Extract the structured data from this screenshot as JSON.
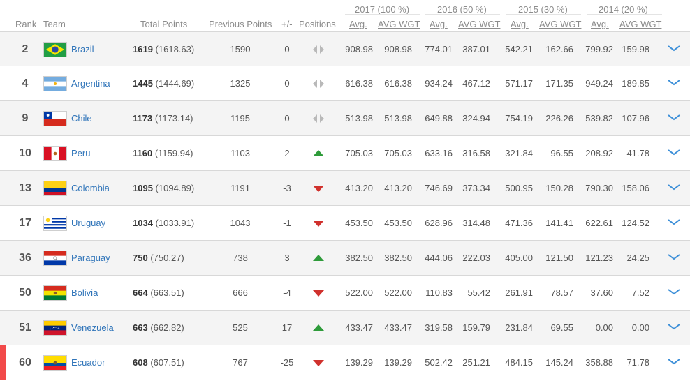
{
  "year_headers": [
    "2017 (100 %)",
    "2016 (50 %)",
    "2015 (30 %)",
    "2014 (20 %)"
  ],
  "columns": {
    "rank": "Rank",
    "team": "Team",
    "total": "Total Points",
    "previous": "Previous Points",
    "change": "+/-",
    "positions": "Positions",
    "avg": "Avg.",
    "avg_wgt": "AVG WGT"
  },
  "colors": {
    "link": "#2f74b9",
    "up": "#2e9b3a",
    "down": "#d0312d",
    "highlight": "#f24a4a"
  },
  "rows": [
    {
      "rank": "2",
      "team": "Brazil",
      "flag": "brazil",
      "total": "1619",
      "total_exact": "(1618.63)",
      "previous": "1590",
      "change": "0",
      "trend": "same",
      "y2017_avg": "908.98",
      "y2017_wgt": "908.98",
      "y2016_avg": "774.01",
      "y2016_wgt": "387.01",
      "y2015_avg": "542.21",
      "y2015_wgt": "162.66",
      "y2014_avg": "799.92",
      "y2014_wgt": "159.98"
    },
    {
      "rank": "4",
      "team": "Argentina",
      "flag": "argentina",
      "total": "1445",
      "total_exact": "(1444.69)",
      "previous": "1325",
      "change": "0",
      "trend": "same",
      "y2017_avg": "616.38",
      "y2017_wgt": "616.38",
      "y2016_avg": "934.24",
      "y2016_wgt": "467.12",
      "y2015_avg": "571.17",
      "y2015_wgt": "171.35",
      "y2014_avg": "949.24",
      "y2014_wgt": "189.85"
    },
    {
      "rank": "9",
      "team": "Chile",
      "flag": "chile",
      "total": "1173",
      "total_exact": "(1173.14)",
      "previous": "1195",
      "change": "0",
      "trend": "same",
      "y2017_avg": "513.98",
      "y2017_wgt": "513.98",
      "y2016_avg": "649.88",
      "y2016_wgt": "324.94",
      "y2015_avg": "754.19",
      "y2015_wgt": "226.26",
      "y2014_avg": "539.82",
      "y2014_wgt": "107.96"
    },
    {
      "rank": "10",
      "team": "Peru",
      "flag": "peru",
      "total": "1160",
      "total_exact": "(1159.94)",
      "previous": "1103",
      "change": "2",
      "trend": "up",
      "y2017_avg": "705.03",
      "y2017_wgt": "705.03",
      "y2016_avg": "633.16",
      "y2016_wgt": "316.58",
      "y2015_avg": "321.84",
      "y2015_wgt": "96.55",
      "y2014_avg": "208.92",
      "y2014_wgt": "41.78"
    },
    {
      "rank": "13",
      "team": "Colombia",
      "flag": "colombia",
      "total": "1095",
      "total_exact": "(1094.89)",
      "previous": "1191",
      "change": "-3",
      "trend": "down",
      "y2017_avg": "413.20",
      "y2017_wgt": "413.20",
      "y2016_avg": "746.69",
      "y2016_wgt": "373.34",
      "y2015_avg": "500.95",
      "y2015_wgt": "150.28",
      "y2014_avg": "790.30",
      "y2014_wgt": "158.06"
    },
    {
      "rank": "17",
      "team": "Uruguay",
      "flag": "uruguay",
      "total": "1034",
      "total_exact": "(1033.91)",
      "previous": "1043",
      "change": "-1",
      "trend": "down",
      "y2017_avg": "453.50",
      "y2017_wgt": "453.50",
      "y2016_avg": "628.96",
      "y2016_wgt": "314.48",
      "y2015_avg": "471.36",
      "y2015_wgt": "141.41",
      "y2014_avg": "622.61",
      "y2014_wgt": "124.52"
    },
    {
      "rank": "36",
      "team": "Paraguay",
      "flag": "paraguay",
      "total": "750",
      "total_exact": "(750.27)",
      "previous": "738",
      "change": "3",
      "trend": "up",
      "y2017_avg": "382.50",
      "y2017_wgt": "382.50",
      "y2016_avg": "444.06",
      "y2016_wgt": "222.03",
      "y2015_avg": "405.00",
      "y2015_wgt": "121.50",
      "y2014_avg": "121.23",
      "y2014_wgt": "24.25"
    },
    {
      "rank": "50",
      "team": "Bolivia",
      "flag": "bolivia",
      "total": "664",
      "total_exact": "(663.51)",
      "previous": "666",
      "change": "-4",
      "trend": "down",
      "y2017_avg": "522.00",
      "y2017_wgt": "522.00",
      "y2016_avg": "110.83",
      "y2016_wgt": "55.42",
      "y2015_avg": "261.91",
      "y2015_wgt": "78.57",
      "y2014_avg": "37.60",
      "y2014_wgt": "7.52"
    },
    {
      "rank": "51",
      "team": "Venezuela",
      "flag": "venezuela",
      "total": "663",
      "total_exact": "(662.82)",
      "previous": "525",
      "change": "17",
      "trend": "up",
      "y2017_avg": "433.47",
      "y2017_wgt": "433.47",
      "y2016_avg": "319.58",
      "y2016_wgt": "159.79",
      "y2015_avg": "231.84",
      "y2015_wgt": "69.55",
      "y2014_avg": "0.00",
      "y2014_wgt": "0.00"
    },
    {
      "rank": "60",
      "team": "Ecuador",
      "flag": "ecuador",
      "total": "608",
      "total_exact": "(607.51)",
      "previous": "767",
      "change": "-25",
      "trend": "down",
      "highlighted": true,
      "y2017_avg": "139.29",
      "y2017_wgt": "139.29",
      "y2016_avg": "502.42",
      "y2016_wgt": "251.21",
      "y2015_avg": "484.15",
      "y2015_wgt": "145.24",
      "y2014_avg": "358.88",
      "y2014_wgt": "71.78"
    }
  ]
}
